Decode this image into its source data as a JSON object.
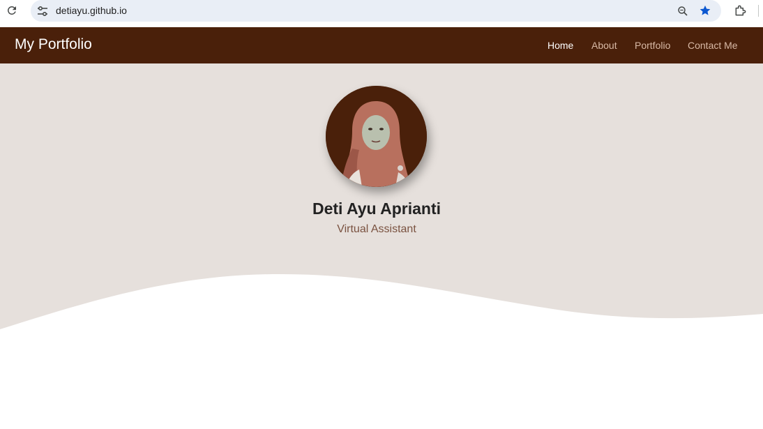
{
  "browser": {
    "url": "detiayu.github.io",
    "icons": {
      "reload": "reload-icon",
      "site_info": "tune-icon",
      "zoom": "zoom-icon",
      "bookmark": "star-icon",
      "extensions": "puzzle-icon"
    },
    "colors": {
      "omnibox": "#e9eef6",
      "star": "#0b57d0"
    }
  },
  "navbar": {
    "brand": "My Portfolio",
    "links": [
      {
        "label": "Home",
        "active": true
      },
      {
        "label": "About",
        "active": false
      },
      {
        "label": "Portfolio",
        "active": false
      },
      {
        "label": "Contact Me",
        "active": false
      }
    ],
    "colors": {
      "background": "#4a200a",
      "link": "#d8b9a6",
      "active_link": "#ffffff"
    }
  },
  "hero": {
    "name": "Deti Ayu Aprianti",
    "role": "Virtual Assistant",
    "colors": {
      "background": "#e6e0dc",
      "name": "#222222",
      "role": "#7a5240"
    }
  }
}
